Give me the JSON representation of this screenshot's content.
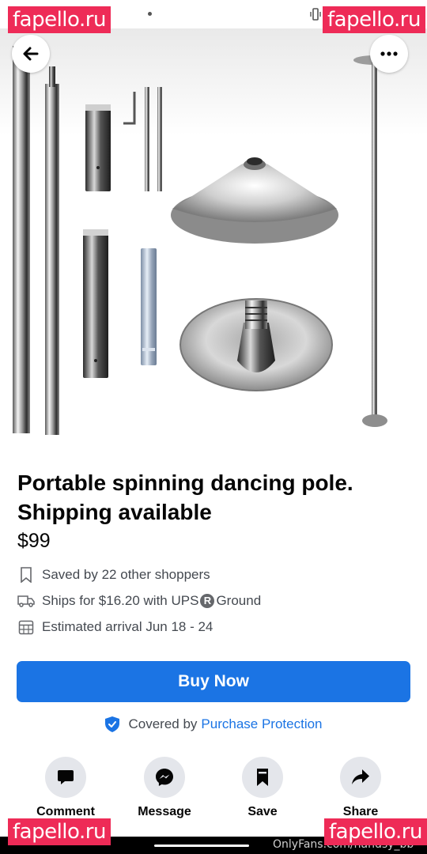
{
  "watermarks": {
    "top_left": "fapello.ru",
    "top_right": "fapello.ru",
    "bottom_left": "fapello.ru",
    "bottom_right": "fapello.ru"
  },
  "product_image": {
    "carousel_pages": 5,
    "current_page": 1
  },
  "listing": {
    "title": "Portable spinning dancing pole. Shipping available",
    "price": "$99",
    "saved_text": "Saved by 22 other shoppers",
    "shipping_prefix": "Ships for $16.20 with UPS",
    "shipping_registered": "R",
    "shipping_suffix": "Ground",
    "arrival_text": "Estimated arrival Jun 18 - 24"
  },
  "buy_button_label": "Buy Now",
  "protection": {
    "prefix": "Covered by",
    "link": "Purchase Protection"
  },
  "actions": [
    {
      "label": "Comment",
      "icon": "comment-icon"
    },
    {
      "label": "Message",
      "icon": "messenger-icon"
    },
    {
      "label": "Save",
      "icon": "bookmark-icon"
    },
    {
      "label": "Share",
      "icon": "share-icon"
    }
  ],
  "footer_credit": "OnlyFans.com/nandsy_bb",
  "colors": {
    "accent": "#1b74e4",
    "watermark": "#ee2b57",
    "action_circle": "#e4e6eb"
  }
}
